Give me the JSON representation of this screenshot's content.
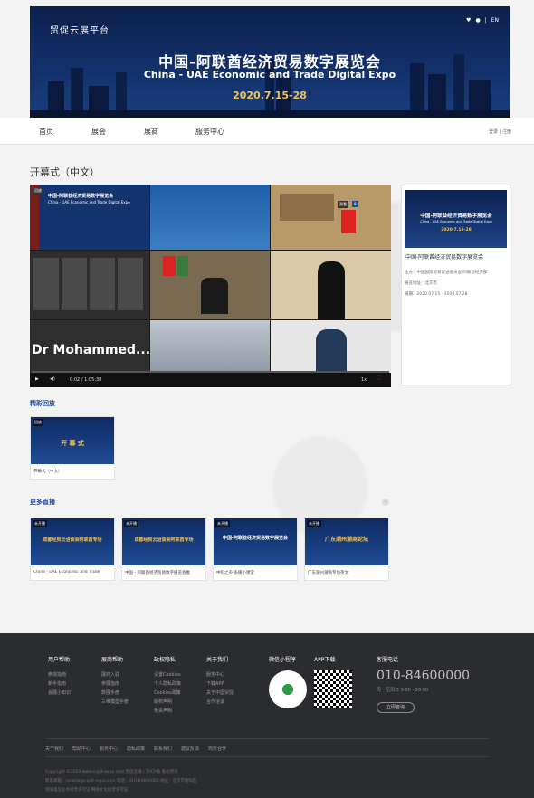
{
  "banner": {
    "brand": "贸促云展平台",
    "icons": [
      "heart-icon",
      "user-icon"
    ],
    "lang_sep": "|",
    "lang": "EN",
    "title_cn": "中国-阿联酋经济贸易数字展览会",
    "title_en": "China - UAE Economic and Trade Digital Expo",
    "date": "2020.7.15-28"
  },
  "nav": {
    "items": [
      "首页",
      "展会",
      "展商",
      "服务中心"
    ],
    "login": "登录",
    "register": "注册",
    "sep": "|"
  },
  "page": {
    "title": "开幕式（中文）"
  },
  "player": {
    "replay_badge": "回放",
    "slide_title_cn": "中国-阿联酋经济贸易数字展览会",
    "slide_title_en": "China - UAE Economic and Trade Digital Expo",
    "presenter_name": "Dr Mohammed...",
    "viewer_tag": "观看",
    "viewer_count": "8",
    "time": "0:02 / 1:05:38",
    "speed": "1x",
    "colors": {
      "bg": "#1a1a1a",
      "controls": "#111111"
    }
  },
  "info": {
    "thumb_title_cn": "中国-阿联酋经济贸易数字展览会",
    "thumb_title_en": "China - UAE Economic and Trade Digital Expo",
    "thumb_date": "2020.7.15-28",
    "title": "中国-阿联酋经济贸易数字展览会",
    "organizer": "主办：中国国际贸易促进委员会,阿联酋经济部",
    "location": "展览地址：北京市",
    "period": "展期：2020.07.15 - 2020.07.28"
  },
  "highlights": {
    "title": "精彩回放",
    "cards": [
      {
        "badge": "回放",
        "thumb_title": "开 幕 式",
        "caption": "开幕式（中文）"
      }
    ]
  },
  "more": {
    "title": "更多直播",
    "cards": [
      {
        "badge": "未开播",
        "thumb_title": "成都经贸云洽谈会阿联酋专场",
        "caption": "China - UAE Economic and Trade"
      },
      {
        "badge": "未开播",
        "thumb_title": "成都经贸云洽谈会阿联酋专场",
        "caption": "中国 - 阿联酋经济贸易数字展览会推"
      },
      {
        "badge": "未开播",
        "thumb_title": "中国-阿联酋经济贸易数字展览会",
        "caption": "中阿之声·多媒小课堂"
      },
      {
        "badge": "未开播",
        "thumb_title": "广东潮州潮商论坛",
        "caption": "广东潮州潮商专场英文"
      }
    ]
  },
  "footer": {
    "columns": [
      {
        "head": "用户帮助",
        "links": [
          "参观指南",
          "新手指南",
          "会展小知识"
        ]
      },
      {
        "head": "展商帮助",
        "links": [
          "展商入驻",
          "参展指南",
          "数展手册",
          "三维模型手册"
        ]
      },
      {
        "head": "政权隐私",
        "links": [
          "设置Cookies",
          "个人隐私政策",
          "Cookies政策",
          "版权声明",
          "免责声明"
        ]
      },
      {
        "head": "关于我们",
        "links": [
          "服务中心",
          "下载APP",
          "关于中国贸促",
          "合作洽谈"
        ]
      }
    ],
    "wechat_head": "微信小程序",
    "app_head": "APP下载",
    "service_head": "客服电话",
    "phone": "010-84600000",
    "hours": "周一至周日 9:00 - 20:00",
    "consult": "立即咨询",
    "bottom_links": [
      "关于我们",
      "帮助中心",
      "服务中心",
      "隐私政策",
      "联系我们",
      "建议反馈",
      "商务合作"
    ],
    "copyright": "Copyright ©2020 www.ccpit-expo.com 贸促云展 | 京ICP备 版权所有",
    "contact": "联系邮箱：service@ccpit-expo.com 电话：010-84600000 地址：北京市朝阳区",
    "license": "增值电信业务经营许可证 网络文化经营许可证"
  }
}
